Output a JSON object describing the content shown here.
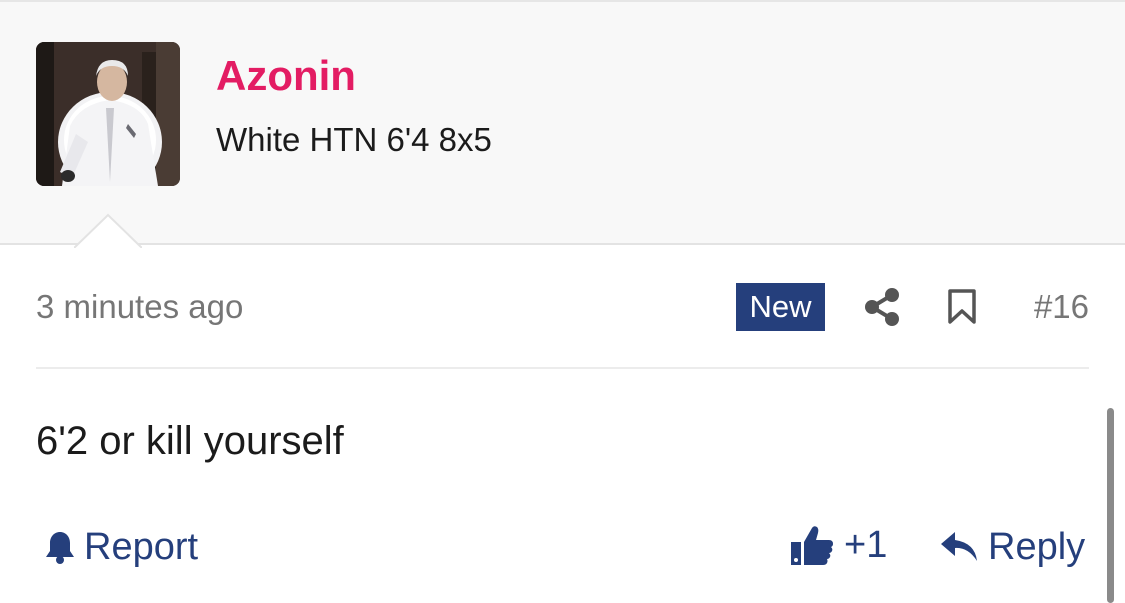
{
  "post": {
    "username": "Azonin",
    "user_title": "White HTN 6'4 8x5",
    "timestamp": "3 minutes ago",
    "badge": "New",
    "post_number": "#16",
    "body": "6'2 or kill yourself"
  },
  "actions": {
    "report_label": "Report",
    "like_count": "+1",
    "reply_label": "Reply"
  },
  "icons": {
    "avatar": "avatar-photo",
    "share": "share-icon",
    "bookmark": "bookmark-icon",
    "report": "bell-icon",
    "like": "thumbs-up-icon",
    "reply": "reply-arrow-icon"
  },
  "colors": {
    "username": "#e31c63",
    "accent": "#253f7c",
    "muted_text": "#767676",
    "header_bg": "#f8f8f8"
  }
}
